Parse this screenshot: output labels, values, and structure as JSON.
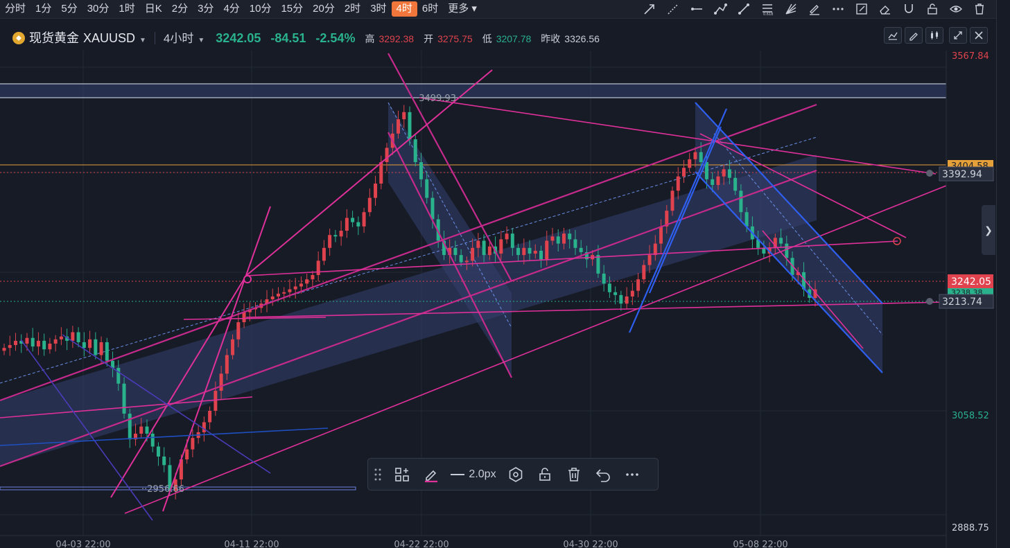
{
  "timeframes": [
    {
      "label": "分时",
      "active": false
    },
    {
      "label": "1分",
      "active": false
    },
    {
      "label": "5分",
      "active": false
    },
    {
      "label": "30分",
      "active": false
    },
    {
      "label": "1时",
      "active": false
    },
    {
      "label": "日K",
      "active": false
    },
    {
      "label": "2分",
      "active": false
    },
    {
      "label": "3分",
      "active": false
    },
    {
      "label": "4分",
      "active": false
    },
    {
      "label": "10分",
      "active": false
    },
    {
      "label": "15分",
      "active": false
    },
    {
      "label": "20分",
      "active": false
    },
    {
      "label": "2时",
      "active": false
    },
    {
      "label": "3时",
      "active": false
    },
    {
      "label": "4时",
      "active": true
    },
    {
      "label": "6时",
      "active": false
    },
    {
      "label": "更多",
      "active": false
    }
  ],
  "symbol": {
    "name": "现货黄金",
    "code": "XAUUSD",
    "period": "4小时",
    "price": "3242.05",
    "change": "-84.51",
    "change_pct": "-2.54%",
    "high_label": "高",
    "high": "3292.38",
    "open_label": "开",
    "open": "3275.75",
    "low_label": "低",
    "low": "3207.78",
    "prev_label": "昨收",
    "prev": "3326.56"
  },
  "toolbar": {
    "width_label": "2.0px"
  },
  "colors": {
    "up": "#e0434d",
    "down": "#2ab28c",
    "drawing_magenta": "#e0309a",
    "drawing_blue": "#2f5ff0",
    "channel_fill": "#2e3a66",
    "accent": "#f0763b"
  },
  "chart_data": {
    "type": "candlestick",
    "title": "",
    "xlabel": "",
    "ylabel": "",
    "ylim": [
      2880,
      3580
    ],
    "x_tick_labels": [
      "04-03 22:00",
      "04-11 22:00",
      "04-22 22:00",
      "04-30 22:00",
      "05-08 22:00"
    ],
    "y_tick_labels": [
      "3567.84",
      "3058.52",
      "2888.75"
    ],
    "last_price": "3242.05",
    "price_labels": [
      {
        "text": "3404.58",
        "color": "#e5a03a"
      },
      {
        "text": "3392.94",
        "color": "#d0d4dc"
      },
      {
        "text": "3238.38",
        "color": "#2ab28c"
      },
      {
        "text": "3213.74",
        "color": "#d0d4dc"
      }
    ],
    "annotations": [
      "3499.93",
      "2956.66"
    ],
    "close_series": [
      3160,
      3164,
      3170,
      3166,
      3174,
      3162,
      3170,
      3158,
      3166,
      3172,
      3176,
      3170,
      3182,
      3168,
      3160,
      3172,
      3150,
      3168,
      3142,
      3132,
      3110,
      3068,
      3032,
      3040,
      3050,
      3040,
      3022,
      3008,
      2996,
      2960,
      2976,
      3004,
      3018,
      3034,
      3042,
      3056,
      3072,
      3100,
      3124,
      3150,
      3172,
      3196,
      3210,
      3214,
      3216,
      3222,
      3228,
      3232,
      3236,
      3238,
      3242,
      3246,
      3250,
      3256,
      3262,
      3282,
      3300,
      3318,
      3316,
      3324,
      3342,
      3336,
      3330,
      3350,
      3370,
      3390,
      3420,
      3440,
      3460,
      3480,
      3490,
      3452,
      3420,
      3396,
      3370,
      3340,
      3310,
      3290,
      3300,
      3290,
      3280,
      3282,
      3300,
      3310,
      3290,
      3302,
      3292,
      3312,
      3320,
      3300,
      3290,
      3300,
      3292,
      3296,
      3284,
      3310,
      3316,
      3306,
      3320,
      3312,
      3300,
      3294,
      3284,
      3290,
      3264,
      3250,
      3238,
      3234,
      3222,
      3232,
      3240,
      3256,
      3276,
      3290,
      3306,
      3330,
      3352,
      3380,
      3400,
      3412,
      3424,
      3434,
      3420,
      3396,
      3388,
      3400,
      3410,
      3398,
      3380,
      3350,
      3330,
      3312,
      3300,
      3292,
      3300,
      3314,
      3306,
      3286,
      3262,
      3266,
      3242,
      3230,
      3242
    ]
  }
}
